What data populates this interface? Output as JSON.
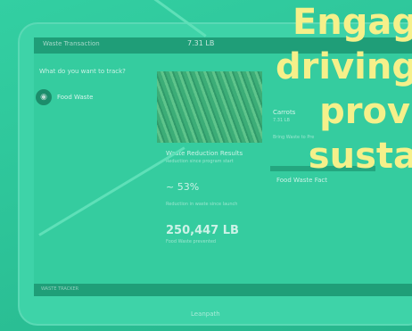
{
  "headline": {
    "lines": [
      "Engag",
      "driving",
      "prov",
      "susta"
    ],
    "color": "#f5f08a"
  },
  "app": {
    "header_title": "Waste Transaction",
    "weight_display": "7.31 LB",
    "question": "What do you want to track?",
    "category_label": "Food Waste",
    "category_icon": "waste-bin-icon"
  },
  "item": {
    "name": "Carrots",
    "weight": "7.31 LB",
    "note": "Bring Waste to Pre"
  },
  "results": {
    "title": "Waste Reduction Results",
    "subtitle": "Reduction since program start",
    "percent": "~ 53%",
    "since": "Reduction in waste since launch",
    "pounds": "250,447 LB",
    "pounds_sub": "Food Waste prevented"
  },
  "facts": {
    "title": "Food Waste Fact"
  },
  "footer": {
    "status": "WASTE TRACKER",
    "brand": "Leanpath"
  },
  "colors": {
    "overlay": "#2fc79b",
    "bar": "#1f9e78"
  }
}
